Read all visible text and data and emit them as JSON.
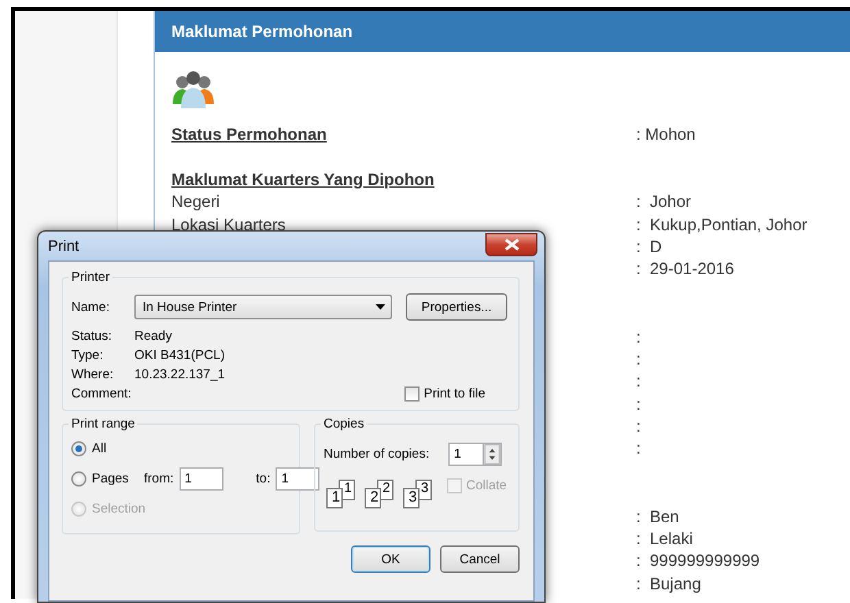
{
  "panel": {
    "title": "Maklumat Permohonan",
    "status": {
      "label": "Status Permohonan",
      "value": ": Mohon"
    },
    "section_title": "Maklumat Kuarters Yang Dipohon",
    "row_groups": [
      [
        {
          "label": "Negeri",
          "value": ":  Johor"
        },
        {
          "label": "Lokasi Kuarters",
          "value": ":  Kukup,Pontian, Johor"
        },
        {
          "value": ":  D"
        },
        {
          "value": ":  29-01-2016"
        }
      ],
      [
        {
          "value": ":"
        },
        {
          "value": ":"
        },
        {
          "value": ":"
        },
        {
          "value": ":"
        },
        {
          "value": ":"
        },
        {
          "value": ":"
        }
      ],
      [
        {
          "value": ":  Ben"
        },
        {
          "value": ":  Lelaki"
        },
        {
          "value": ":  999999999999"
        },
        {
          "value": ":  Bujang"
        }
      ]
    ]
  },
  "print_dialog": {
    "title": "Print",
    "printer": {
      "legend": "Printer",
      "name_label": "Name:",
      "name_value": "In House Printer",
      "properties_button": "Properties...",
      "info": [
        {
          "label": "Status:",
          "value": "Ready"
        },
        {
          "label": "Type:",
          "value": "OKI B431(PCL)"
        },
        {
          "label": "Where:",
          "value": "10.23.22.137_1"
        },
        {
          "label": "Comment:"
        }
      ],
      "print_to_file": {
        "label": "Print to file",
        "checked": false
      }
    },
    "print_range": {
      "legend": "Print range",
      "options": [
        {
          "label": "All",
          "selected": true,
          "disabled": false
        },
        {
          "label": "Pages",
          "selected": false,
          "disabled": false
        },
        {
          "label": "Selection",
          "selected": false,
          "disabled": true
        }
      ],
      "from_label": "from:",
      "from_value": "1",
      "to_label": "to:",
      "to_value": "1"
    },
    "copies": {
      "legend": "Copies",
      "number_label": "Number of copies:",
      "number_value": "1",
      "collate_pages": [
        "1",
        "1",
        "2",
        "2",
        "3",
        "3"
      ],
      "collate": {
        "label": "Collate",
        "checked": false,
        "disabled": true
      }
    },
    "buttons": [
      {
        "label": "OK",
        "default": true
      },
      {
        "label": "Cancel",
        "default": false
      }
    ]
  }
}
